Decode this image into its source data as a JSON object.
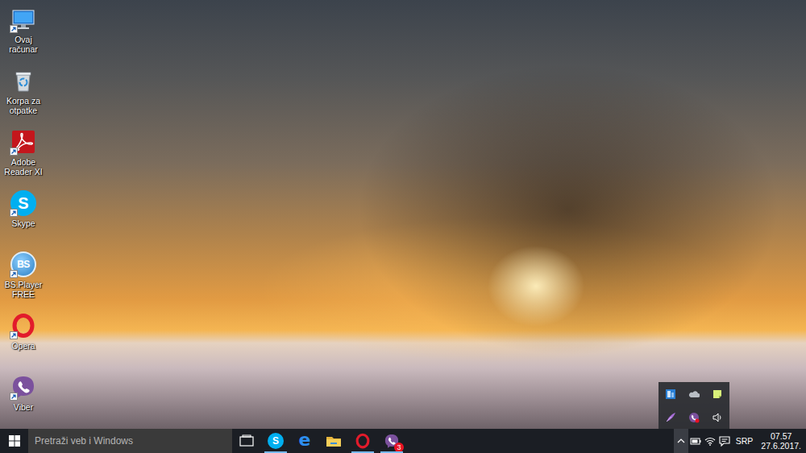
{
  "desktop": {
    "icons": [
      {
        "label": "Ovaj računar",
        "kind": "pc",
        "shortcut": true
      },
      {
        "label": "Korpa za otpatke",
        "kind": "recycle",
        "shortcut": false
      },
      {
        "label": "Adobe Reader XI",
        "kind": "adobe",
        "shortcut": true
      },
      {
        "label": "Skype",
        "kind": "skype",
        "shortcut": true,
        "logo": "S"
      },
      {
        "label": "BS.Player FREE",
        "kind": "bsplayer",
        "shortcut": true,
        "logo": "BS"
      },
      {
        "label": "Opera",
        "kind": "opera",
        "shortcut": true
      },
      {
        "label": "Viber",
        "kind": "viber",
        "shortcut": true
      }
    ]
  },
  "taskbar": {
    "search": {
      "placeholder": "Pretraži veb i Windows"
    },
    "apps": [
      {
        "kind": "taskview",
        "running": false
      },
      {
        "kind": "skype",
        "running": true,
        "logo": "S"
      },
      {
        "kind": "edge",
        "running": false,
        "logo": "e"
      },
      {
        "kind": "explorer",
        "running": false
      },
      {
        "kind": "opera",
        "running": true
      },
      {
        "kind": "viber",
        "running": true,
        "badge": "3"
      }
    ],
    "tray": {
      "overflow_open": true,
      "icons": [
        {
          "kind": "battery"
        },
        {
          "kind": "wifi"
        },
        {
          "kind": "notifications"
        }
      ],
      "language": "SRP",
      "time": "07.57",
      "date": "27.6.2017."
    }
  },
  "tray_overflow": {
    "icons": [
      {
        "kind": "intel"
      },
      {
        "kind": "onedrive"
      },
      {
        "kind": "notes"
      },
      {
        "kind": "pen"
      },
      {
        "kind": "viber"
      },
      {
        "kind": "volume"
      }
    ]
  }
}
